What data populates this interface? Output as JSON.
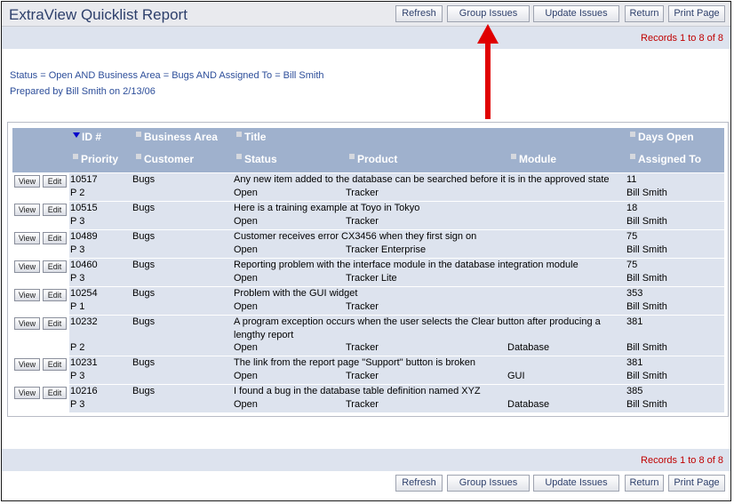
{
  "app_title": "ExtraView Quicklist Report",
  "toolbar": {
    "refresh": "Refresh",
    "group_issues": "Group Issues",
    "update_issues": "Update Issues",
    "return": "Return",
    "print_page": "Print Page"
  },
  "records_text": "Records 1 to 8 of 8",
  "filter_text": "Status = Open AND Business Area = Bugs AND Assigned To = Bill Smith",
  "prepared_text": "Prepared by Bill Smith on 2/13/06",
  "columns": {
    "id": "ID #",
    "business_area": "Business Area",
    "title": "Title",
    "days_open": "Days Open",
    "priority": "Priority",
    "customer": "Customer",
    "status": "Status",
    "product": "Product",
    "module": "Module",
    "assigned_to": "Assigned To"
  },
  "row_buttons": {
    "view": "View",
    "edit": "Edit"
  },
  "rows": [
    {
      "id": "10517",
      "business_area": "Bugs",
      "title": "Any new item added to the database can be searched before it is in the approved state",
      "days_open": "11",
      "priority": "P 2",
      "status": "Open",
      "product": "Tracker",
      "module": "",
      "assigned_to": "Bill Smith"
    },
    {
      "id": "10515",
      "business_area": "Bugs",
      "title": "Here is a training example at Toyo in Tokyo",
      "days_open": "18",
      "priority": "P 3",
      "status": "Open",
      "product": "Tracker",
      "module": "",
      "assigned_to": "Bill Smith"
    },
    {
      "id": "10489",
      "business_area": "Bugs",
      "title": "Customer receives error CX3456 when they first sign on",
      "days_open": "75",
      "priority": "P 3",
      "status": "Open",
      "product": "Tracker Enterprise",
      "module": "",
      "assigned_to": "Bill Smith"
    },
    {
      "id": "10460",
      "business_area": "Bugs",
      "title": "Reporting problem with the interface module in the database integration module",
      "days_open": "75",
      "priority": "P 3",
      "status": "Open",
      "product": "Tracker Lite",
      "module": "",
      "assigned_to": "Bill Smith"
    },
    {
      "id": "10254",
      "business_area": "Bugs",
      "title": "Problem with the GUI widget",
      "days_open": "353",
      "priority": "P 1",
      "status": "Open",
      "product": "Tracker",
      "module": "",
      "assigned_to": "Bill Smith"
    },
    {
      "id": "10232",
      "business_area": "Bugs",
      "title": "A program exception occurs when the user selects the Clear button after producing a lengthy report",
      "days_open": "381",
      "priority": "P 2",
      "status": "Open",
      "product": "Tracker",
      "module": "Database",
      "assigned_to": "Bill Smith"
    },
    {
      "id": "10231",
      "business_area": "Bugs",
      "title": "The link from the report page \"Support\" button is broken",
      "days_open": "381",
      "priority": "P 3",
      "status": "Open",
      "product": "Tracker",
      "module": "GUI",
      "assigned_to": "Bill Smith"
    },
    {
      "id": "10216",
      "business_area": "Bugs",
      "title": "I found a bug in the database table definition named XYZ",
      "days_open": "385",
      "priority": "P 3",
      "status": "Open",
      "product": "Tracker",
      "module": "Database",
      "assigned_to": "Bill Smith"
    }
  ],
  "colors": {
    "accent_red": "#e00000",
    "header_blue": "#9fb1cd",
    "row_band": "#dde3ee",
    "title_text": "#2d3f6b"
  },
  "icons": {
    "sort": "sort-descending-icon",
    "column_marker": "column-square-icon",
    "annotation": "red-arrow-annotation"
  }
}
